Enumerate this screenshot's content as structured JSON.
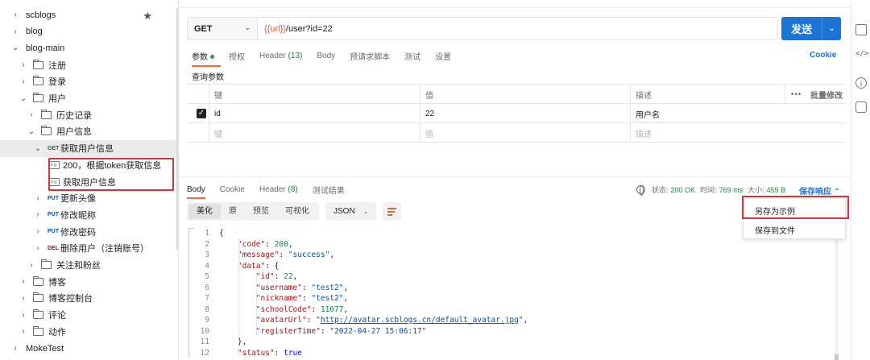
{
  "sidebar": {
    "items": [
      {
        "label": "scblogs",
        "depth": 0,
        "kind": "collection",
        "chev": "›",
        "starred": true
      },
      {
        "label": "blog",
        "depth": 0,
        "kind": "collection",
        "chev": "›"
      },
      {
        "label": "blog-main",
        "depth": 0,
        "kind": "collection",
        "chev": "⌄"
      },
      {
        "label": "注册",
        "depth": 1,
        "kind": "folder",
        "chev": "›"
      },
      {
        "label": "登录",
        "depth": 1,
        "kind": "folder",
        "chev": "›"
      },
      {
        "label": "用户",
        "depth": 1,
        "kind": "folder",
        "chev": "⌄"
      },
      {
        "label": "历史记录",
        "depth": 2,
        "kind": "folder",
        "chev": "›"
      },
      {
        "label": "用户信息",
        "depth": 2,
        "kind": "folder",
        "chev": "⌄"
      },
      {
        "label": "获取用户信息",
        "depth": 3,
        "kind": "request",
        "method": "GET",
        "chev": "⌄",
        "selected": true
      },
      {
        "label": "200，根据token获取信息",
        "depth": 4,
        "kind": "example"
      },
      {
        "label": "获取用户信息",
        "depth": 4,
        "kind": "example"
      },
      {
        "label": "更新头像",
        "depth": 3,
        "kind": "request",
        "method": "PUT",
        "chev": "›"
      },
      {
        "label": "修改昵称",
        "depth": 3,
        "kind": "request",
        "method": "PUT",
        "chev": "›"
      },
      {
        "label": "修改密码",
        "depth": 3,
        "kind": "request",
        "method": "PUT",
        "chev": "›"
      },
      {
        "label": "删除用户（注销账号）",
        "depth": 3,
        "kind": "request",
        "method": "DEL",
        "chev": "›"
      },
      {
        "label": "关注和粉丝",
        "depth": 2,
        "kind": "folder",
        "chev": "›"
      },
      {
        "label": "博客",
        "depth": 1,
        "kind": "folder",
        "chev": "›"
      },
      {
        "label": "博客控制台",
        "depth": 1,
        "kind": "folder",
        "chev": "›"
      },
      {
        "label": "评论",
        "depth": 1,
        "kind": "folder",
        "chev": "›"
      },
      {
        "label": "动作",
        "depth": 1,
        "kind": "folder",
        "chev": "›"
      },
      {
        "label": "MokeTest",
        "depth": 0,
        "kind": "collection",
        "chev": "›"
      }
    ],
    "example_icon_text": "e.g."
  },
  "request": {
    "method": "GET",
    "url_var": "{{url}}",
    "url_path": "/user?id=22",
    "send_label": "发送",
    "tabs": [
      {
        "label": "参数",
        "active": true,
        "dot": true
      },
      {
        "label": "授权"
      },
      {
        "label": "Header",
        "count": " (13)"
      },
      {
        "label": "Body"
      },
      {
        "label": "预请求脚本"
      },
      {
        "label": "测试"
      },
      {
        "label": "设置"
      }
    ],
    "cookie_label": "Cookie",
    "query_title": "查询参数",
    "table": {
      "headers": {
        "key": "键",
        "value": "值",
        "desc": "描述",
        "more": "•••",
        "bulk": "批量修改"
      },
      "rows": [
        {
          "key": "id",
          "value": "22",
          "desc": "用户名",
          "checked": true
        }
      ],
      "placeholder": {
        "key": "键",
        "value": "值",
        "desc": "描述"
      }
    }
  },
  "response": {
    "tabs": [
      {
        "label": "Body",
        "active": true
      },
      {
        "label": "Cookie"
      },
      {
        "label": "Header",
        "count": " (8)"
      },
      {
        "label": "测试结果"
      }
    ],
    "status_label": "状态:",
    "status_value": "200 OK",
    "time_label": "时间:",
    "time_value": "769 ms",
    "size_label": "大小:",
    "size_value": "459 B",
    "save_label": "保存响应 ⌃",
    "formats": [
      "美化",
      "原",
      "预览",
      "可视化"
    ],
    "format_select": "JSON",
    "menu": {
      "items": [
        "另存为示例",
        "保存到文件"
      ]
    },
    "code_lines": [
      [
        {
          "t": "{",
          "c": "p"
        }
      ],
      [
        {
          "t": "    ",
          "c": "p"
        },
        {
          "t": "\"code\"",
          "c": "k"
        },
        {
          "t": ": ",
          "c": "p"
        },
        {
          "t": "200",
          "c": "n"
        },
        {
          "t": ",",
          "c": "p"
        }
      ],
      [
        {
          "t": "    ",
          "c": "p"
        },
        {
          "t": "\"message\"",
          "c": "k"
        },
        {
          "t": ": ",
          "c": "p"
        },
        {
          "t": "\"success\"",
          "c": "s"
        },
        {
          "t": ",",
          "c": "p"
        }
      ],
      [
        {
          "t": "    ",
          "c": "p"
        },
        {
          "t": "\"data\"",
          "c": "k"
        },
        {
          "t": ": {",
          "c": "p"
        }
      ],
      [
        {
          "t": "        ",
          "c": "p"
        },
        {
          "t": "\"id\"",
          "c": "k"
        },
        {
          "t": ": ",
          "c": "p"
        },
        {
          "t": "22",
          "c": "n"
        },
        {
          "t": ",",
          "c": "p"
        }
      ],
      [
        {
          "t": "        ",
          "c": "p"
        },
        {
          "t": "\"username\"",
          "c": "k"
        },
        {
          "t": ": ",
          "c": "p"
        },
        {
          "t": "\"test2\"",
          "c": "s"
        },
        {
          "t": ",",
          "c": "p"
        }
      ],
      [
        {
          "t": "        ",
          "c": "p"
        },
        {
          "t": "\"nickname\"",
          "c": "k"
        },
        {
          "t": ": ",
          "c": "p"
        },
        {
          "t": "\"test2\"",
          "c": "s"
        },
        {
          "t": ",",
          "c": "p"
        }
      ],
      [
        {
          "t": "        ",
          "c": "p"
        },
        {
          "t": "\"schoolCode\"",
          "c": "k"
        },
        {
          "t": ": ",
          "c": "p"
        },
        {
          "t": "11077",
          "c": "n"
        },
        {
          "t": ",",
          "c": "p"
        }
      ],
      [
        {
          "t": "        ",
          "c": "p"
        },
        {
          "t": "\"avatarUrl\"",
          "c": "k"
        },
        {
          "t": ": ",
          "c": "p"
        },
        {
          "t": "\"",
          "c": "s"
        },
        {
          "t": "http://avatar.scblogs.cn/default_avatar.jpg",
          "c": "url"
        },
        {
          "t": "\"",
          "c": "s"
        },
        {
          "t": ",",
          "c": "p"
        }
      ],
      [
        {
          "t": "        ",
          "c": "p"
        },
        {
          "t": "\"registerTime\"",
          "c": "k"
        },
        {
          "t": ": ",
          "c": "p"
        },
        {
          "t": "\"2022-04-27 15:06:17\"",
          "c": "s"
        }
      ],
      [
        {
          "t": "    },",
          "c": "p"
        }
      ],
      [
        {
          "t": "    ",
          "c": "p"
        },
        {
          "t": "\"status\"",
          "c": "k"
        },
        {
          "t": ": ",
          "c": "p"
        },
        {
          "t": "true",
          "c": "bool"
        }
      ]
    ]
  },
  "colors": {
    "accent": "#1b74d6",
    "highlight": "#d9323a",
    "tab_underline": "#f26b3a"
  }
}
